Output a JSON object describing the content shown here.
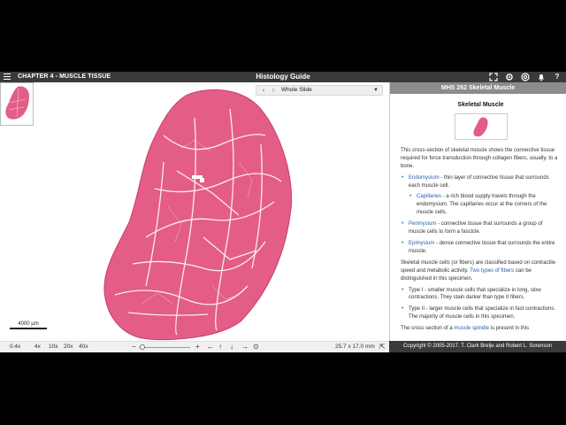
{
  "header": {
    "chapter": "CHAPTER 4 - MUSCLE TISSUE",
    "title": "Histology Guide",
    "icons": [
      "menu-icon",
      "fullscreen-icon",
      "settings-icon",
      "help-ring-icon",
      "bell-icon",
      "question-icon"
    ]
  },
  "viewer": {
    "slide_selector": {
      "prev": "‹",
      "next": "›",
      "value": "Whole Slide"
    },
    "scale_label": "4000 µm",
    "tissue_color": "#e35d86"
  },
  "toolbar": {
    "current_zoom": "0.4x",
    "zoom_levels": [
      "4x",
      "10x",
      "20x",
      "40x"
    ],
    "minus": "−",
    "plus": "+",
    "dimensions": "25.7 x 17.0 mm"
  },
  "panel": {
    "header": "MHS 262 Skeletal Muscle",
    "title": "Skeletal Muscle",
    "intro": "This cross-section of skeletal muscle shows the connective tissue required for force transduction through collagen fibers, usually, to a bone.",
    "items": [
      {
        "term": "Endomysium",
        "text": " - thin layer of connective tissue that surrounds each muscle cell."
      },
      {
        "term": "Capillaries",
        "text": " - a rich blood supply travels through the endomysium. The capillaries occur at the corners of the muscle cells.",
        "sub": true
      },
      {
        "term": "Perimysium",
        "text": " - connective tissue that surrounds a group of muscle cells to form a fascicle."
      },
      {
        "term": "Epimysium",
        "text": " - dense connective tissue that surrounds the entire muscle."
      }
    ],
    "para2_a": "Skeletal muscle cells (or fibers) are classified based on contractile speed and metabolic activity. ",
    "para2_link": "Two types of fibers",
    "para2_b": " can be distinguished in this specimen.",
    "types": [
      {
        "text": "Type I - smaller muscle cells that specialize in long, slow contractions. They stain darker than type II fibers."
      },
      {
        "text": "Type II - larger muscle cells that specialize in fast contractions. The majority of muscle cells in this specimen."
      }
    ],
    "para3_a": "The cross section of a ",
    "para3_link": "muscle spindle",
    "para3_b": " is present in this",
    "footer": "Copyright © 2005-2017. T. Clark Brelje and Robert L. Sorenson"
  }
}
